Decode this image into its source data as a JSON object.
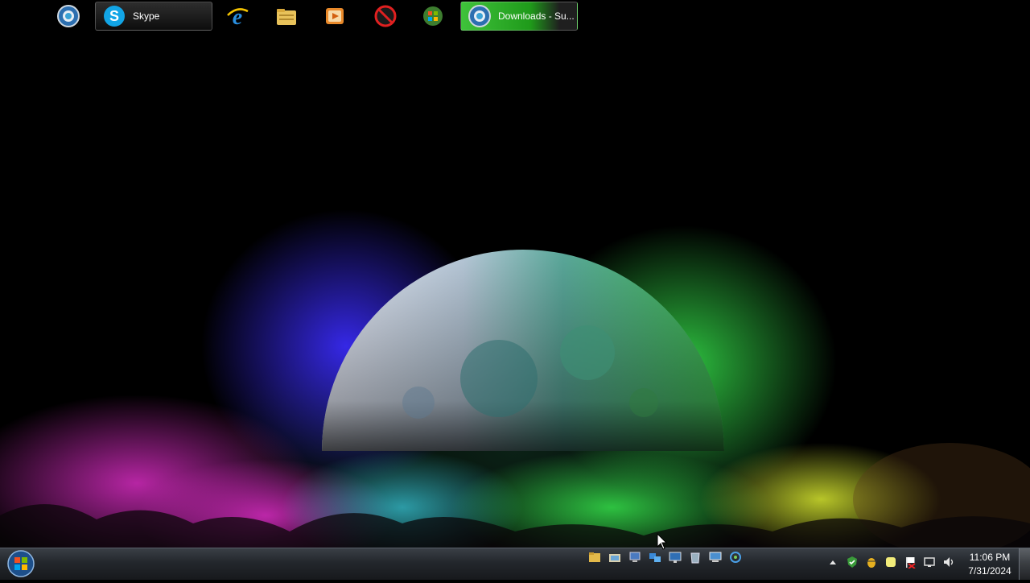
{
  "taskbar": {
    "start_label": "Start",
    "pinned": [
      {
        "name": "browser-globe-icon"
      },
      {
        "name": "skype-icon",
        "label": "Skype"
      },
      {
        "name": "internet-explorer-icon"
      },
      {
        "name": "file-explorer-icon"
      },
      {
        "name": "media-player-icon"
      },
      {
        "name": "blocked-app-icon"
      },
      {
        "name": "windows-flag-icon"
      },
      {
        "name": "browser-globe-icon",
        "label": "Downloads - Su..."
      }
    ],
    "quick_launch": [
      "folder-icon",
      "folder-open-icon",
      "computer-icon",
      "network-icon",
      "monitor-icon",
      "recycle-bin-icon",
      "remote-desktop-icon",
      "network-sharing-icon"
    ],
    "tray_icons": [
      "show-hidden-icons-arrow",
      "security-shield-icon",
      "bug-icon",
      "sticky-note-icon",
      "action-center-flag-icon",
      "network-icon",
      "volume-icon"
    ],
    "clock": {
      "time": "11:06 PM",
      "date": "7/31/2024"
    }
  }
}
